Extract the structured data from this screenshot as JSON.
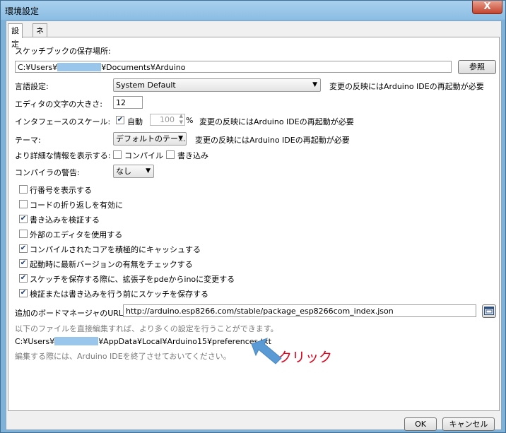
{
  "window": {
    "title": "環境設定",
    "close_glyph": "X"
  },
  "tabs": [
    {
      "label": "設定"
    },
    {
      "label": "ネットワーク"
    }
  ],
  "sketchbook": {
    "label": "スケッチブックの保存場所:",
    "path_prefix": "C:¥Users¥",
    "path_suffix": "¥Documents¥Arduino",
    "browse_label": "参照"
  },
  "language": {
    "label": "言語設定:",
    "value": "System Default",
    "note": "変更の反映にはArduino IDEの再起動が必要"
  },
  "font_size": {
    "label": "エディタの文字の大きさ:",
    "value": "12"
  },
  "scale": {
    "label": "インタフェースのスケール:",
    "auto_label": "自動",
    "auto_checked": true,
    "value": "100",
    "unit": "%",
    "note": "変更の反映にはArduino IDEの再起動が必要"
  },
  "theme": {
    "label": "テーマ:",
    "value": "デフォルトのテー...",
    "note": "変更の反映にはArduino IDEの再起動が必要"
  },
  "verbose": {
    "label": "より詳細な情報を表示する:",
    "compile_label": "コンパイル",
    "compile_checked": false,
    "upload_label": "書き込み",
    "upload_checked": false
  },
  "warnings": {
    "label": "コンパイラの警告:",
    "value": "なし"
  },
  "options": [
    {
      "label": "行番号を表示する",
      "checked": false
    },
    {
      "label": "コードの折り返しを有効に",
      "checked": false
    },
    {
      "label": "書き込みを検証する",
      "checked": true
    },
    {
      "label": "外部のエディタを使用する",
      "checked": false
    },
    {
      "label": "コンパイルされたコアを積極的にキャッシュする",
      "checked": true
    },
    {
      "label": "起動時に最新バージョンの有無をチェックする",
      "checked": true
    },
    {
      "label": "スケッチを保存する際に、拡張子をpdeからinoに変更する",
      "checked": true
    },
    {
      "label": "検証または書き込みを行う前にスケッチを保存する",
      "checked": true
    }
  ],
  "board_manager": {
    "label": "追加のボードマネージャのURL:",
    "value": "http://arduino.esp8266.com/stable/package_esp8266com_index.json"
  },
  "info": {
    "line1": "以下のファイルを直接編集すれば、より多くの設定を行うことができます。",
    "path_prefix": "C:¥Users¥",
    "path_suffix": "¥AppData¥Local¥Arduino15¥preferences.txt",
    "line3": "編集する際には、Arduino IDEを終了させておいてください。"
  },
  "annotation": {
    "text": "クリック",
    "text_color": "#e0001b",
    "arrow_color": "#5b9bd5"
  },
  "footer": {
    "ok_label": "OK",
    "cancel_label": "キャンセル"
  },
  "colors": {
    "redaction": "#9bc6ec",
    "title_bar": "#8bbde3"
  }
}
